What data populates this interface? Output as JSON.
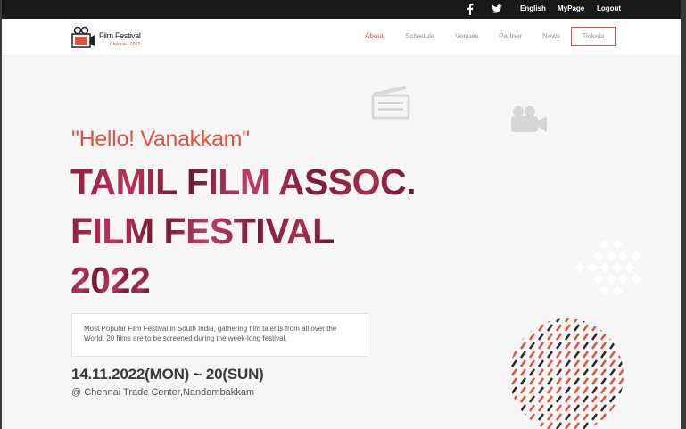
{
  "topbar": {
    "social": [
      {
        "icon": "facebook-icon"
      },
      {
        "icon": "twitter-icon"
      }
    ],
    "links": [
      "English",
      "MyPage",
      "Logout"
    ]
  },
  "logo": {
    "title": "Film Festival",
    "subtitle": "Chennai - 2022",
    "icon": "film-camera-icon"
  },
  "nav": {
    "items": [
      "About",
      "Schedule",
      "Venues",
      "Partner",
      "News"
    ],
    "active": "About",
    "tickets": "Tickets"
  },
  "hero": {
    "greeting": "\"Hello! Vanakkam\"",
    "line1": "TAMIL FILM ASSOC.",
    "line2": "FILM FESTIVAL",
    "line3": "2022",
    "description": "Most Popular Film Festival in South India, gathering film talents from all over the World. 20 films are to be screened during the week-long festival.",
    "dates": "14.11.2022(MON) ~ 20(SUN)",
    "venue": "@ Chennai Trade Center,Nandambakkam"
  },
  "decorations": {
    "icons": [
      "clapperboard-icon",
      "video-camera-icon",
      "diamond-grid-pattern",
      "striped-circle-pattern"
    ]
  },
  "colors": {
    "accent": "#e0533f",
    "topbar": "#191919",
    "hero_text": "#8a2040"
  }
}
